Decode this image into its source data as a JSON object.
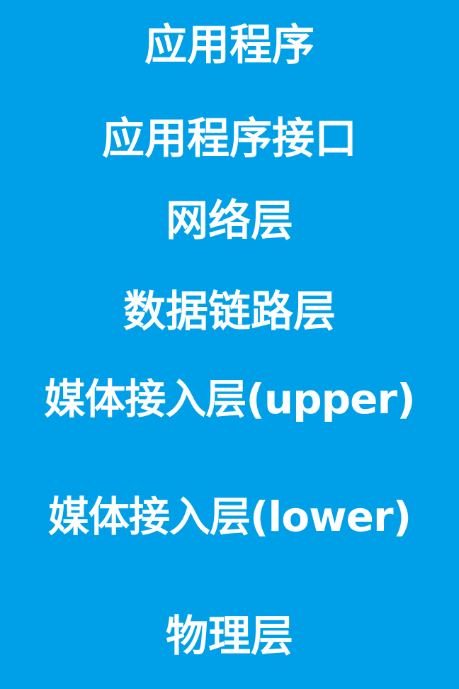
{
  "background_color": "#00A0E9",
  "text_color": "#FFFFFF",
  "layers": [
    "应用程序",
    "应用程序接口",
    "网络层",
    "数据链路层",
    "媒体接入层(upper)",
    "媒体接入层(lower)",
    "物理层"
  ]
}
